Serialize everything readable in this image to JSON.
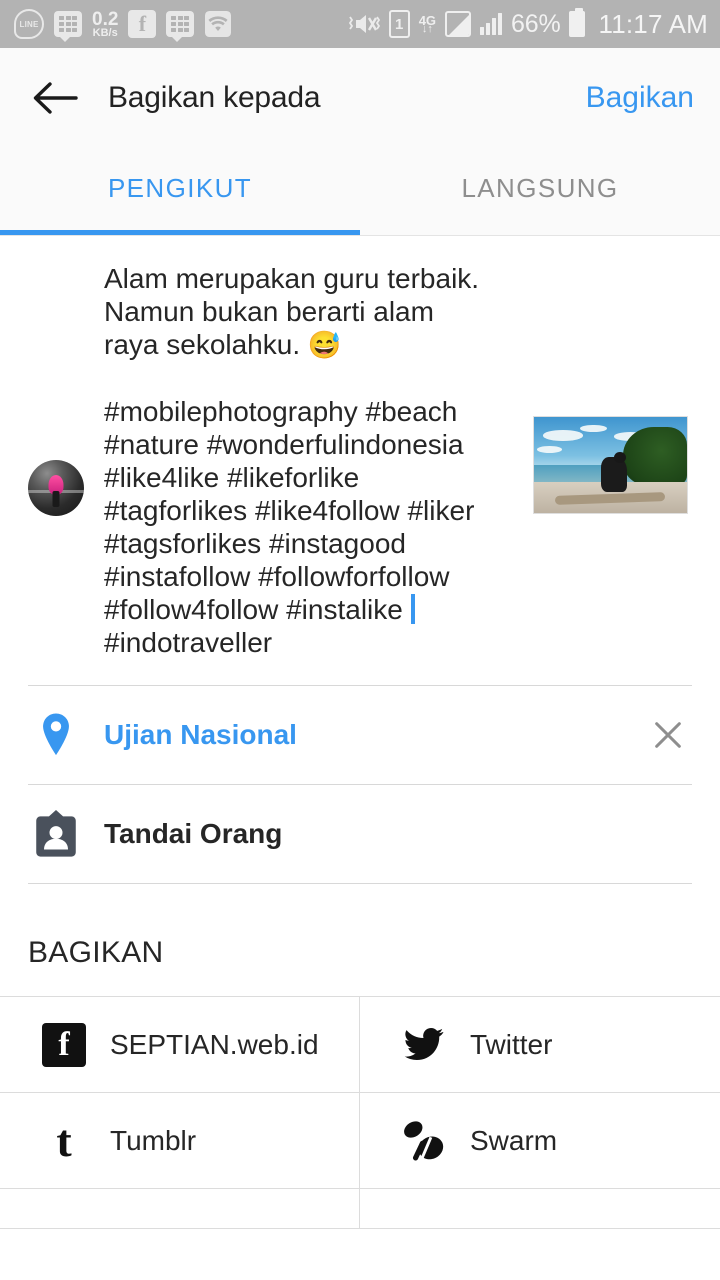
{
  "status_bar": {
    "network_speed_value": "0.2",
    "network_speed_unit": "KB/s",
    "line_label": "LINE",
    "battery_percent": "66%",
    "sim_label": "1",
    "network_type": "4G",
    "clock": "11:17 AM",
    "icons": [
      "line-icon",
      "bbm-icon",
      "network-speed",
      "facebook-icon",
      "bbm-chat-icon",
      "wifi-icon",
      "mute-vibrate-icon",
      "sim-icon",
      "4g-icon",
      "signal-empty-icon",
      "signal-bars-icon",
      "battery-icon"
    ]
  },
  "app_bar": {
    "back_label": "back-arrow",
    "title": "Bagikan kepada",
    "share_action": "Bagikan",
    "accent_color": "#3897f0"
  },
  "tabs": [
    {
      "label": "PENGIKUT",
      "active": true
    },
    {
      "label": "LANGSUNG",
      "active": false
    }
  ],
  "caption": {
    "paragraph": "Alam merupakan guru terbaik. Namun bukan berarti alam raya sekolahku. ",
    "emoji": "😅",
    "blank_line": "",
    "hashtags": "#mobilephotography #beach #nature #wonderfulindonesia #like4like #likeforlike #tagforlikes #like4follow #liker #tagsforlikes #instagood #instafollow #followforfollow #follow4follow #instalike ",
    "hashtag_last": "#indotraveller",
    "caret_visible": true
  },
  "options": [
    {
      "name": "location",
      "icon": "location-pin-icon",
      "label": "Ujian Nasional",
      "style": "link",
      "has_clear": true,
      "clear_icon": "close-icon"
    },
    {
      "name": "tag-people",
      "icon": "tag-person-icon",
      "label": "Tandai Orang",
      "style": "dark",
      "has_clear": false
    }
  ],
  "share_section": {
    "title": "BAGIKAN",
    "items": [
      {
        "icon": "facebook-icon",
        "label": "SEPTIAN.web.id"
      },
      {
        "icon": "twitter-icon",
        "label": "Twitter"
      },
      {
        "icon": "tumblr-icon",
        "label": "Tumblr"
      },
      {
        "icon": "swarm-icon",
        "label": "Swarm"
      }
    ]
  }
}
